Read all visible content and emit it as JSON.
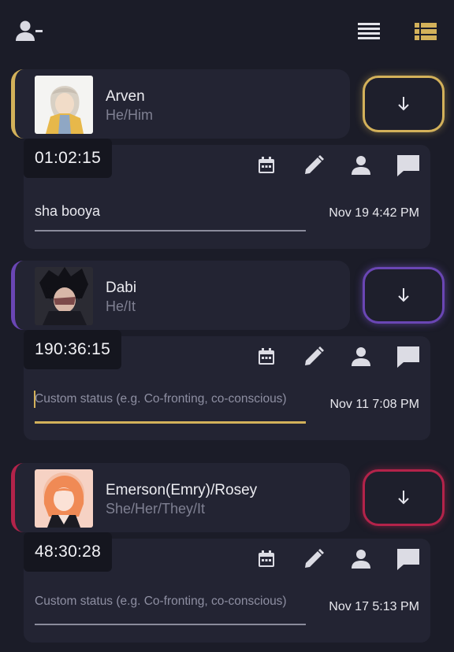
{
  "toolbar": {
    "remove_user_icon": "person-remove-icon",
    "list_view_icon": "list-view-icon",
    "grid_view_icon": "grid-view-icon",
    "active_color": "#d3b15a"
  },
  "members": [
    {
      "name": "Arven",
      "pronouns": "He/Him",
      "timer": "01:02:15",
      "status_value": "sha booya",
      "status_placeholder": "",
      "date": "Nov 19 4:42 PM",
      "accent": "#d3b15a"
    },
    {
      "name": "Dabi",
      "pronouns": "He/It",
      "timer": "190:36:15",
      "status_value": "",
      "status_placeholder": "Custom status (e.g. Co-fronting, co-conscious)",
      "date": "Nov 11 7:08 PM",
      "accent": "#6a46b4"
    },
    {
      "name": "Emerson(Emry)/Rosey",
      "pronouns": "She/Her/They/It",
      "timer": "48:30:28",
      "status_value": "",
      "status_placeholder": "Custom status (e.g. Co-fronting, co-conscious)",
      "date": "Nov 17 5:13 PM",
      "accent": "#b3234a"
    }
  ]
}
